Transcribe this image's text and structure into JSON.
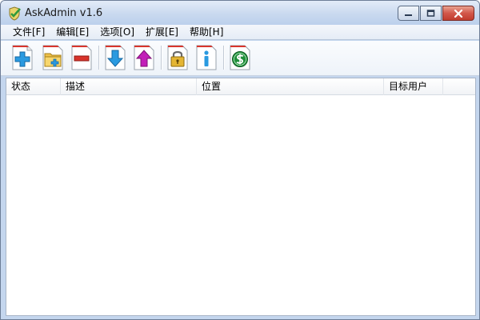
{
  "window": {
    "title": "AskAdmin v1.6",
    "app_icon": "shield-check-icon",
    "controls": [
      "minimize-icon",
      "maximize-icon",
      "close-icon"
    ]
  },
  "menu": {
    "items": [
      {
        "label": "文件[F]"
      },
      {
        "label": "编辑[E]"
      },
      {
        "label": "选项[O]"
      },
      {
        "label": "扩展[E]"
      },
      {
        "label": "帮助[H]"
      }
    ]
  },
  "toolbar": {
    "buttons": [
      {
        "icon": "add-file-icon"
      },
      {
        "icon": "add-folder-icon"
      },
      {
        "icon": "remove-icon"
      },
      {
        "icon": "arrow-down-icon"
      },
      {
        "icon": "arrow-up-icon"
      },
      {
        "icon": "lock-icon"
      },
      {
        "icon": "info-icon"
      },
      {
        "icon": "dollar-icon"
      }
    ]
  },
  "list": {
    "columns": [
      {
        "label": "状态"
      },
      {
        "label": "描述"
      },
      {
        "label": "位置"
      },
      {
        "label": "目标用户"
      },
      {
        "label": ""
      }
    ],
    "rows": []
  },
  "colors": {
    "accent_blue": "#2a9ae0",
    "remove_red": "#d9342b",
    "upload_magenta": "#c21fb8",
    "lock_gold": "#e4b533",
    "dollar_green": "#1f8f3a",
    "close_red": "#c94a3c"
  }
}
